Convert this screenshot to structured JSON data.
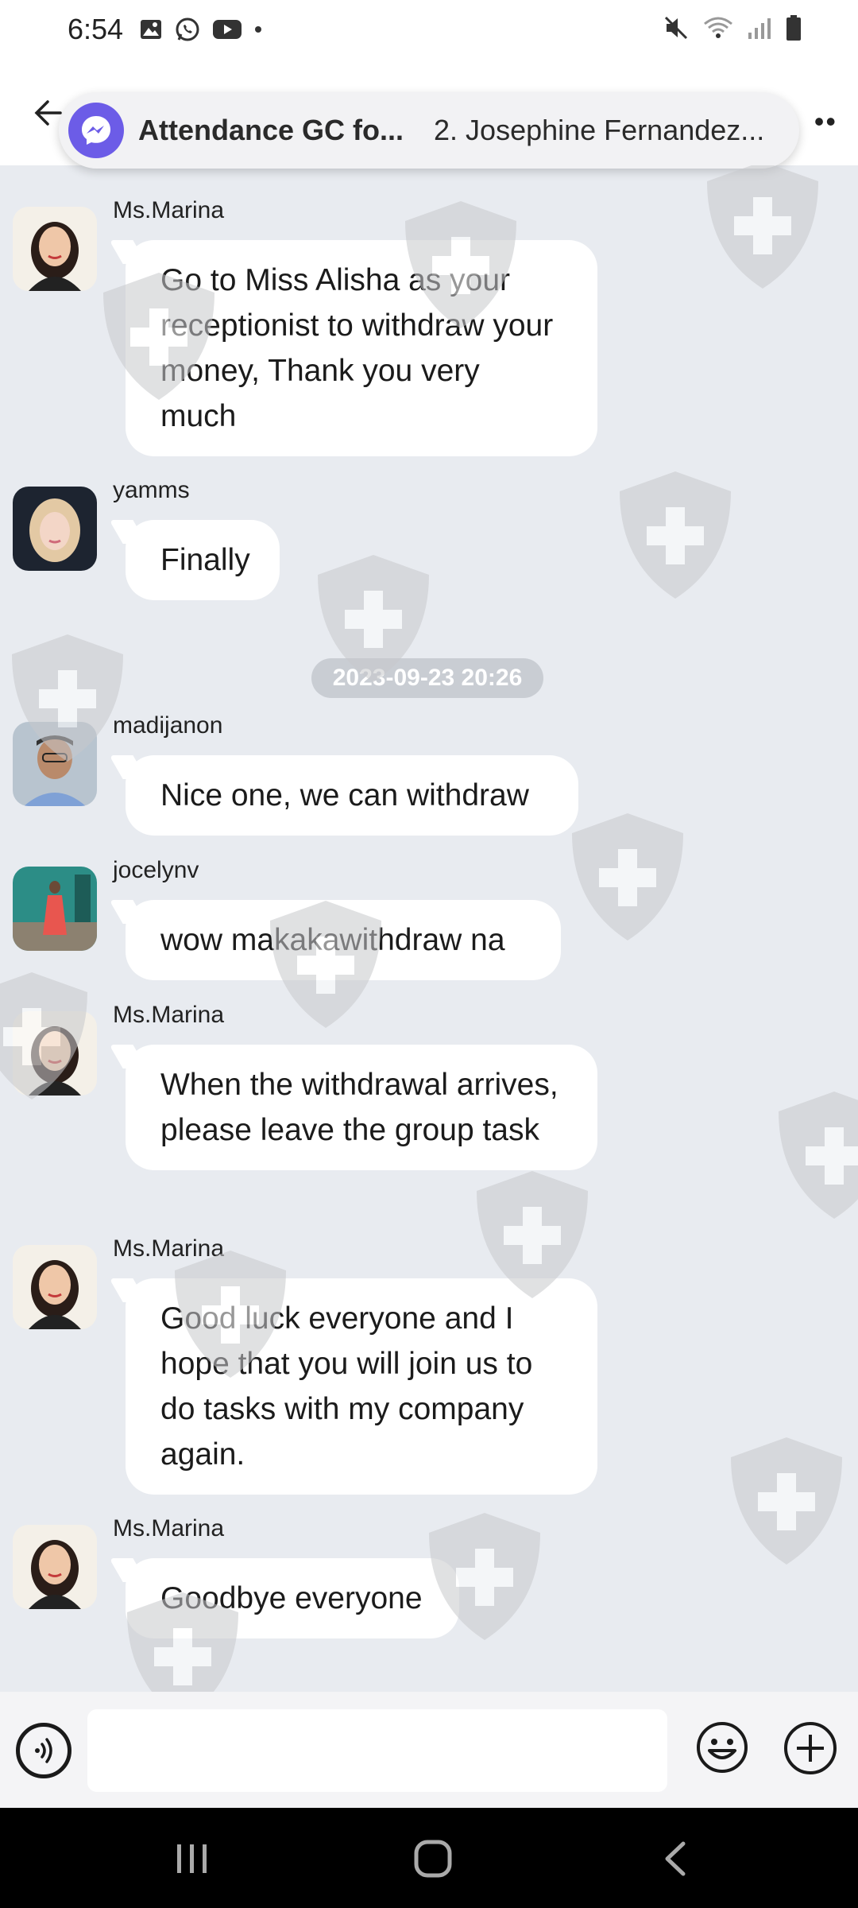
{
  "status_bar": {
    "time": "6:54"
  },
  "header": {
    "group_title": "Attendance GC fo...",
    "member_subtitle": "2. Josephine Fernandez..."
  },
  "chat": {
    "timestamp": "2023-09-23 20:26",
    "messages": [
      {
        "sender": "Ms.Marina",
        "text": " Go to Miss Alisha as your receptionist to withdraw your money, Thank you very much"
      },
      {
        "sender": "yamms",
        "text": "Finally"
      },
      {
        "sender": "madijanon",
        "text": "Nice one, we can withdraw"
      },
      {
        "sender": "jocelynv",
        "text": "wow makakawithdraw na"
      },
      {
        "sender": "Ms.Marina",
        "text": "When the withdrawal arrives, please leave the group task"
      },
      {
        "sender": "Ms.Marina",
        "text": "Good luck everyone and I hope that you will join us to do tasks with my company again."
      },
      {
        "sender": "Ms.Marina",
        "text": "Goodbye everyone"
      }
    ]
  },
  "input": {
    "placeholder": ""
  },
  "icons": {
    "back": "back-arrow-icon",
    "more": "more-icon",
    "messenger": "messenger-icon",
    "voice": "voice-icon",
    "emoji": "emoji-icon",
    "plus": "plus-icon",
    "watermark": "shield-cross-icon"
  },
  "colors": {
    "background": "#E8EBF0",
    "bubble": "#FFFFFF",
    "accent": "#6C5CE7",
    "timestamp_pill": "#C9CDD3"
  }
}
